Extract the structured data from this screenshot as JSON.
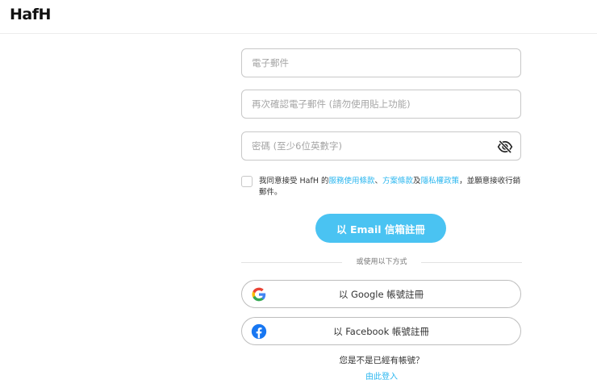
{
  "header": {
    "logo_text": "HafH"
  },
  "form": {
    "email_placeholder": "電子郵件",
    "email_confirm_placeholder": "再次確認電子郵件 (請勿使用貼上功能)",
    "password_placeholder": "密碼 (至少6位英數字)",
    "password_toggle_icon": "eye-slash-icon",
    "consent": {
      "prefix": "我同意接受 HafH 的",
      "terms_link": "服務使用條款",
      "sep1": "、",
      "plan_link": "方案條款",
      "sep2": "及",
      "privacy_link": "隱私權政策",
      "suffix": "，並願意接收行銷郵件。",
      "checked": false
    },
    "email_signup_button": "以 Email 信箱註冊"
  },
  "divider": {
    "text": "或使用以下方式"
  },
  "social": {
    "google_label": "以 Google 帳號註冊",
    "google_icon": "google-logo-icon",
    "facebook_label": "以 Facebook 帳號註冊",
    "facebook_icon": "facebook-logo-icon"
  },
  "footer": {
    "question": "您是不是已經有帳號？",
    "login_link": "由此登入"
  },
  "colors": {
    "accent": "#4ac3f2",
    "link": "#29b6ef",
    "facebook": "#1877f2"
  }
}
